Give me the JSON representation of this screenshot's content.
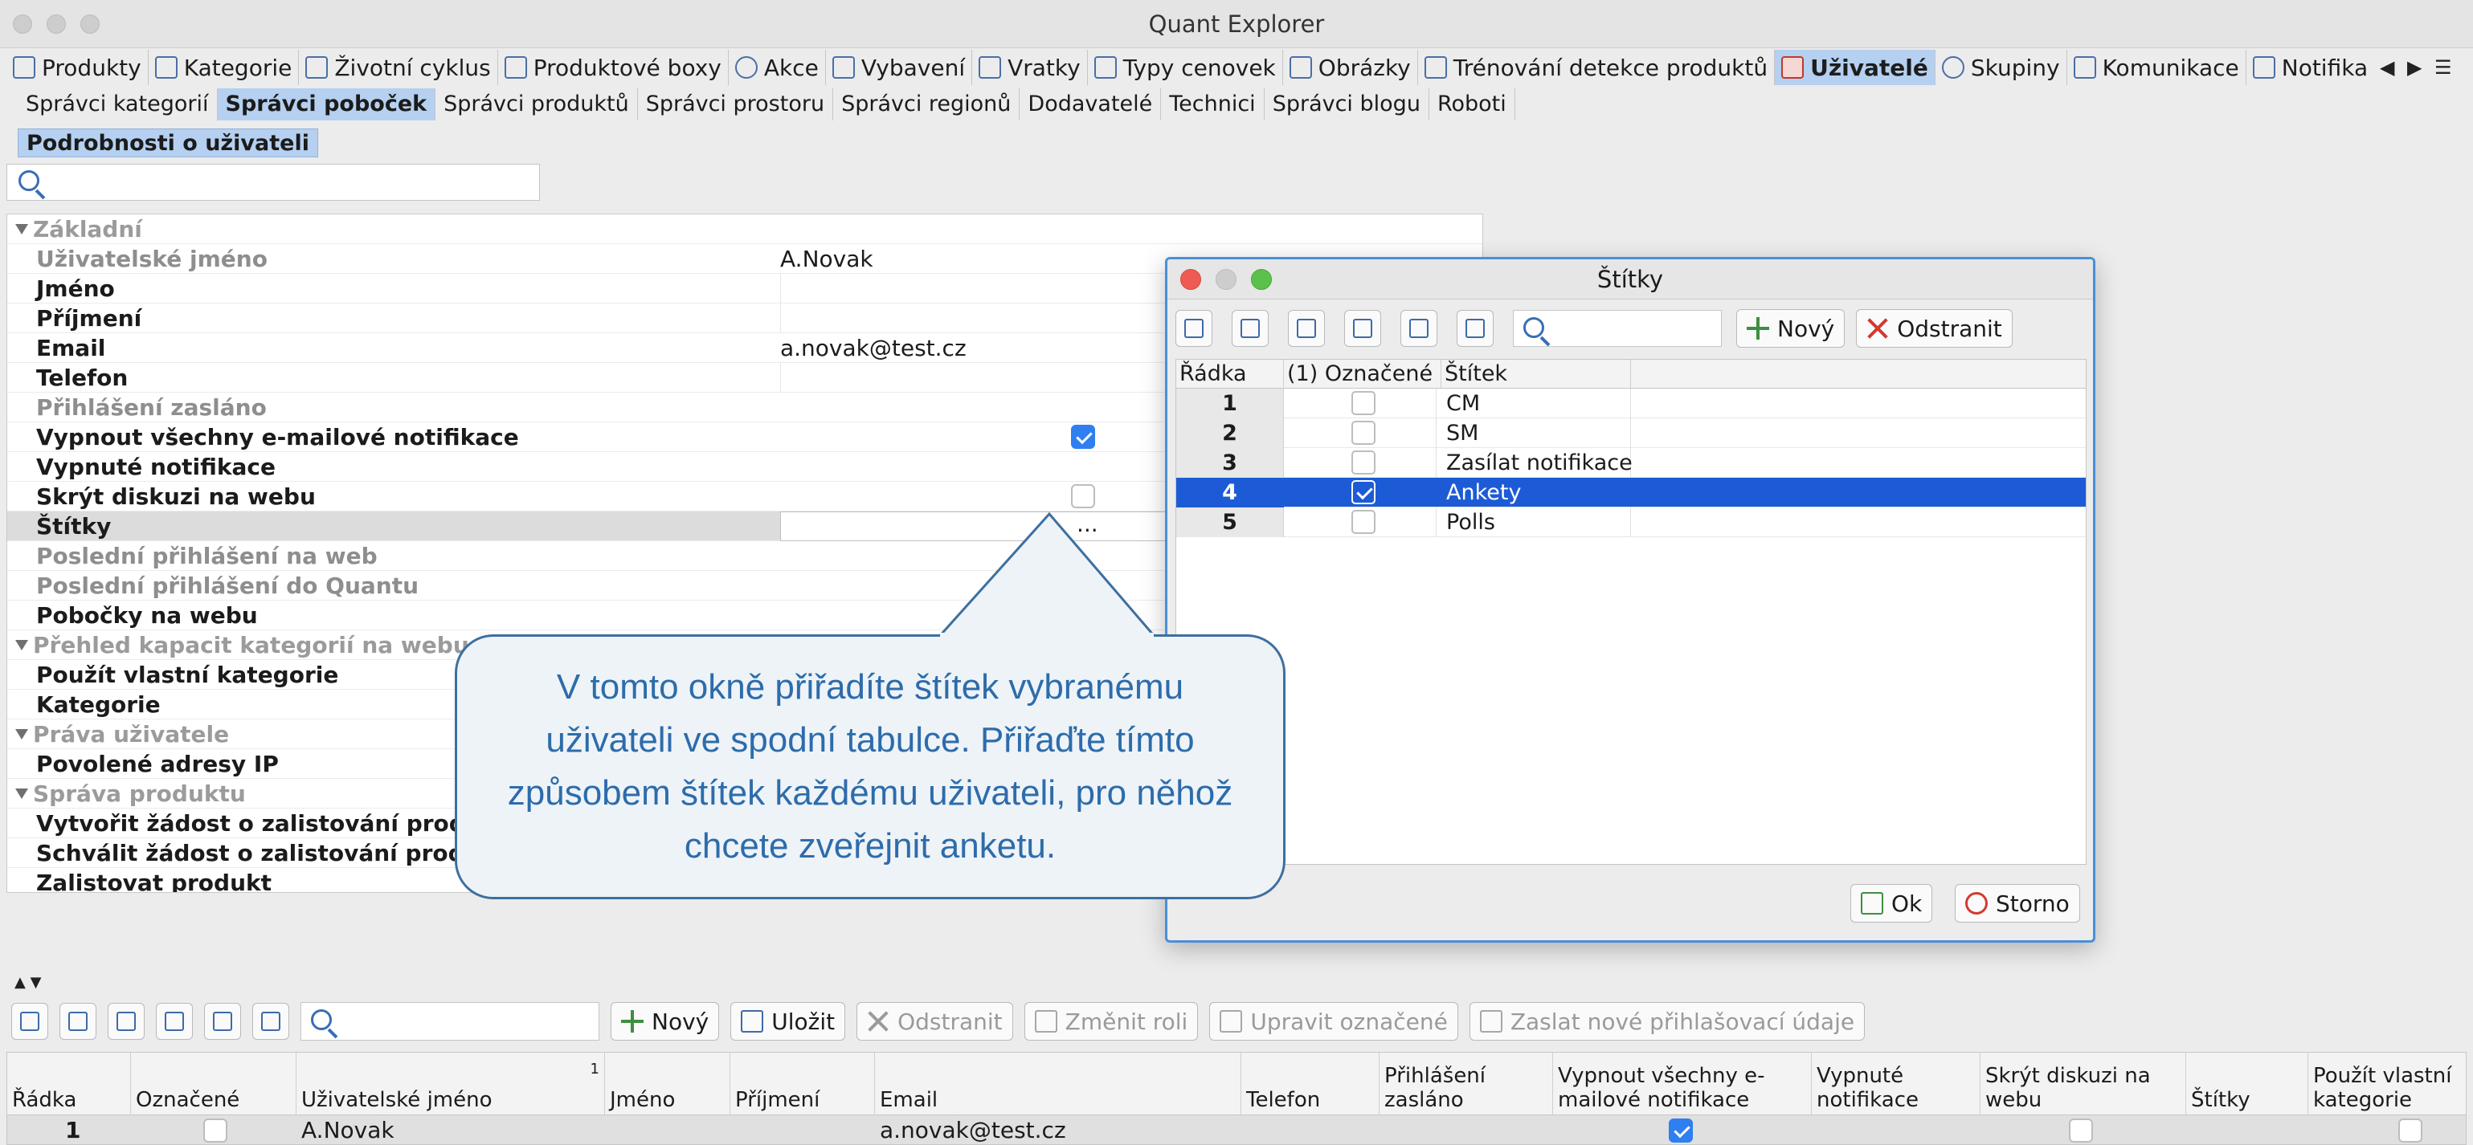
{
  "window": {
    "title": "Quant Explorer"
  },
  "main_tabs": [
    {
      "label": "Produkty",
      "icon": "products-icon"
    },
    {
      "label": "Kategorie",
      "icon": "list-icon"
    },
    {
      "label": "Životní cyklus",
      "icon": "lifecycle-icon"
    },
    {
      "label": "Produktové boxy",
      "icon": "box-icon"
    },
    {
      "label": "Akce",
      "icon": "clock-icon"
    },
    {
      "label": "Vybavení",
      "icon": "equipment-icon"
    },
    {
      "label": "Vratky",
      "icon": "returns-icon"
    },
    {
      "label": "Typy cenovek",
      "icon": "tag-icon"
    },
    {
      "label": "Obrázky",
      "icon": "image-icon"
    },
    {
      "label": "Trénování detekce produktů",
      "icon": "training-icon"
    },
    {
      "label": "Uživatelé",
      "icon": "user-icon"
    },
    {
      "label": "Skupiny",
      "icon": "group-icon"
    },
    {
      "label": "Komunikace",
      "icon": "mail-icon"
    },
    {
      "label": "Notifikac",
      "icon": "notification-icon"
    }
  ],
  "tab_nav": {
    "prev": "◀",
    "next": "▶",
    "menu": "☰"
  },
  "sub_tabs": [
    "Správci kategorií",
    "Správci poboček",
    "Správci produktů",
    "Správci prostoru",
    "Správci regionů",
    "Dodavatelé",
    "Technici",
    "Správci blogu",
    "Roboti"
  ],
  "detail_tab": "Podrobnosti o uživateli",
  "properties": {
    "sections": {
      "basic": "Základní",
      "capacity": "Přehled kapacit kategorií na webu",
      "rights": "Práva uživatele",
      "product": "Správa produktu"
    },
    "rows": {
      "username": {
        "label": "Uživatelské jméno",
        "value": "A.Novak"
      },
      "first_name": {
        "label": "Jméno"
      },
      "last_name": {
        "label": "Příjmení"
      },
      "email": {
        "label": "Email",
        "value": "a.novak@test.cz"
      },
      "phone": {
        "label": "Telefon"
      },
      "login_sent": {
        "label": "Přihlášení zasláno"
      },
      "disable_all": {
        "label": "Vypnout všechny e-mailové notifikace",
        "checked": true
      },
      "disabled_notif": {
        "label": "Vypnuté notifikace"
      },
      "hide_discussion": {
        "label": "Skrýt diskuzi na webu",
        "checked": false
      },
      "labels": {
        "label": "Štítky",
        "value": "..."
      },
      "last_web_login": {
        "label": "Poslední přihlášení na web"
      },
      "last_quant_login": {
        "label": "Poslední přihlášení do Quantu"
      },
      "branches_web": {
        "label": "Pobočky na webu"
      },
      "own_category": {
        "label": "Použít vlastní kategorie"
      },
      "category": {
        "label": "Kategorie"
      },
      "allowed_ip": {
        "label": "Povolené adresy IP"
      },
      "create_request": {
        "label": "Vytvořit žádost o zalistování produktu"
      },
      "approve_request": {
        "label": "Schválit žádost o zalistování produktu"
      },
      "list_product": {
        "label": "Zalistovat produkt"
      }
    }
  },
  "bottom_toolbar": {
    "new": "Nový",
    "save": "Uložit",
    "delete": "Odstranit",
    "change_role": "Změnit roli",
    "edit_selected": "Upravit označené",
    "send_login": "Zaslat nové přihlašovací údaje"
  },
  "grid": {
    "columns": [
      "Řádka",
      "Označené",
      "Uživatelské jméno",
      "Jméno",
      "Příjmení",
      "Email",
      "Telefon",
      "Přihlášení zasláno",
      "Vypnout všechny e-mailové notifikace",
      "Vypnuté notifikace",
      "Skrýt diskuzi na webu",
      "Štítky",
      "Použít vlastní kategorie"
    ],
    "sort_marker": "1",
    "rows": [
      {
        "row": "1",
        "username": "A.Novak",
        "email": "a.novak@test.cz",
        "disable_all": true
      }
    ]
  },
  "dialog": {
    "title": "Štítky",
    "new": "Nový",
    "delete": "Odstranit",
    "columns": [
      "Řádka",
      "(1) Označené",
      "Štítek"
    ],
    "rows": [
      {
        "num": "1",
        "label": "CM",
        "checked": false
      },
      {
        "num": "2",
        "label": "SM",
        "checked": false
      },
      {
        "num": "3",
        "label": "Zasílat notifikace",
        "checked": false
      },
      {
        "num": "4",
        "label": "Ankety",
        "checked": true
      },
      {
        "num": "5",
        "label": "Polls",
        "checked": false
      }
    ],
    "ok": "Ok",
    "cancel": "Storno"
  },
  "callout": {
    "text": "V tomto okně přiřadíte štítek vybranému uživateli ve spodní tabulce. Přiřaďte tímto způsobem štítek každému uživateli, pro něhož chcete zveřejnit anketu."
  },
  "colors": {
    "selection": "#1d5bd6",
    "active_tab": "#b5d0f0",
    "callout_text": "#2d6cab",
    "callout_border": "#3d6f9f"
  }
}
